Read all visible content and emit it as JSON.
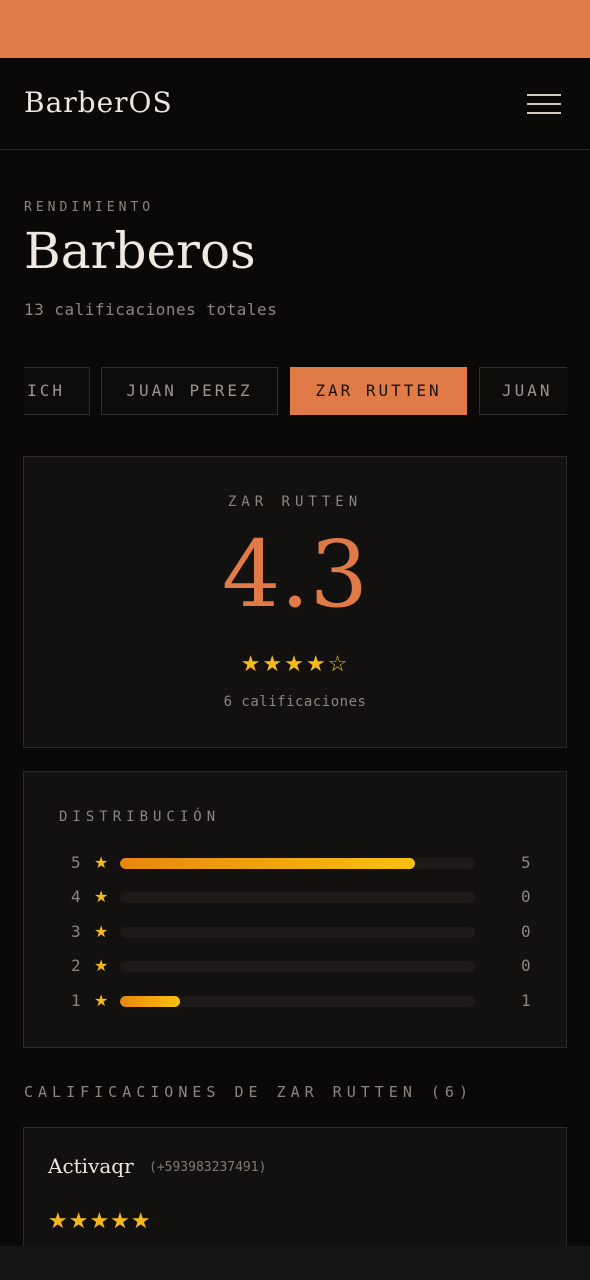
{
  "app": {
    "brand": "BarberOS"
  },
  "header": {
    "eyebrow": "RENDIMIENTO",
    "title": "Barberos",
    "subtitle": "13 calificaciones totales"
  },
  "tabs": [
    {
      "label": "ICH",
      "active": false
    },
    {
      "label": "JUAN PEREZ",
      "active": false
    },
    {
      "label": "ZAR RUTTEN",
      "active": true
    },
    {
      "label": "JUAN",
      "active": false
    }
  ],
  "summary": {
    "name": "ZAR RUTTEN",
    "rating": "4.3",
    "stars": "★★★★☆",
    "count_text": "6 calificaciones"
  },
  "distribution": {
    "title": "DISTRIBUCIÓN",
    "rows": [
      {
        "stars": "5",
        "count": "5",
        "fraction": 0.83
      },
      {
        "stars": "4",
        "count": "0",
        "fraction": 0
      },
      {
        "stars": "3",
        "count": "0",
        "fraction": 0
      },
      {
        "stars": "2",
        "count": "0",
        "fraction": 0
      },
      {
        "stars": "1",
        "count": "1",
        "fraction": 0.17
      }
    ]
  },
  "reviews": {
    "section_title": "CALIFICACIONES DE ZAR RUTTEN (6)",
    "items": [
      {
        "name": "Activaqr",
        "phone": "(+593983237491)",
        "stars": "★★★★★"
      }
    ]
  },
  "colors": {
    "accent": "#e07b48",
    "star": "#f5b91e",
    "background": "#0a0908",
    "card": "#121110"
  },
  "icons": {
    "menu": "hamburger-menu-icon",
    "star": "star-icon"
  }
}
